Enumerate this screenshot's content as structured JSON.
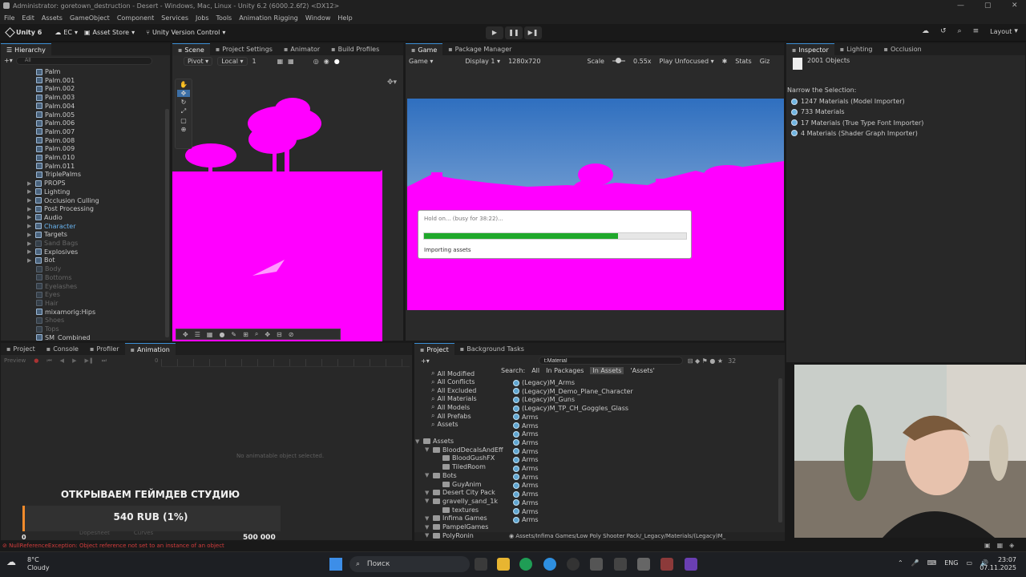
{
  "window": {
    "title": "Administrator: goretown_destruction - Desert - Windows, Mac, Linux - Unity 6.2 (6000.2.6f2) <DX12>"
  },
  "menu": [
    "File",
    "Edit",
    "Assets",
    "GameObject",
    "Component",
    "Services",
    "Jobs",
    "Tools",
    "Animation Rigging",
    "Window",
    "Help"
  ],
  "toolbar": {
    "brand": "Unity 6",
    "account": "EC",
    "asset_store": "Asset Store",
    "version_control": "Unity Version Control",
    "layout": "Layout"
  },
  "hierarchy": {
    "tab": "Hierarchy",
    "search_placeholder": "All",
    "items": [
      {
        "label": "Palm",
        "indent": 2,
        "dim": false
      },
      {
        "label": "Palm.001",
        "indent": 2,
        "dim": false
      },
      {
        "label": "Palm.002",
        "indent": 2,
        "dim": false
      },
      {
        "label": "Palm.003",
        "indent": 2,
        "dim": false
      },
      {
        "label": "Palm.004",
        "indent": 2,
        "dim": false
      },
      {
        "label": "Palm.005",
        "indent": 2,
        "dim": false
      },
      {
        "label": "Palm.006",
        "indent": 2,
        "dim": false
      },
      {
        "label": "Palm.007",
        "indent": 2,
        "dim": false
      },
      {
        "label": "Palm.008",
        "indent": 2,
        "dim": false
      },
      {
        "label": "Palm.009",
        "indent": 2,
        "dim": false
      },
      {
        "label": "Palm.010",
        "indent": 2,
        "dim": false
      },
      {
        "label": "Palm.011",
        "indent": 2,
        "dim": false
      },
      {
        "label": "TriplePalms",
        "indent": 2,
        "dim": false
      },
      {
        "label": "PROPS",
        "indent": 1,
        "dim": false
      },
      {
        "label": "Lighting",
        "indent": 1,
        "dim": false
      },
      {
        "label": "Occlusion Culling",
        "indent": 1,
        "dim": false
      },
      {
        "label": "Post Processing",
        "indent": 1,
        "dim": false
      },
      {
        "label": "Audio",
        "indent": 1,
        "dim": false
      },
      {
        "label": "Character",
        "indent": 1,
        "dim": false,
        "selected": true
      },
      {
        "label": "Targets",
        "indent": 1,
        "dim": false
      },
      {
        "label": "Sand Bags",
        "indent": 1,
        "dim": true
      },
      {
        "label": "Explosives",
        "indent": 1,
        "dim": false
      },
      {
        "label": "Bot",
        "indent": 1,
        "dim": false
      },
      {
        "label": "Body",
        "indent": 2,
        "dim": true
      },
      {
        "label": "Bottoms",
        "indent": 2,
        "dim": true
      },
      {
        "label": "Eyelashes",
        "indent": 2,
        "dim": true
      },
      {
        "label": "Eyes",
        "indent": 2,
        "dim": true
      },
      {
        "label": "Hair",
        "indent": 2,
        "dim": true
      },
      {
        "label": "mixamorig:Hips",
        "indent": 2,
        "dim": false
      },
      {
        "label": "Shoes",
        "indent": 2,
        "dim": true
      },
      {
        "label": "Tops",
        "indent": 2,
        "dim": true
      },
      {
        "label": "SM_Combined",
        "indent": 2,
        "dim": false
      }
    ]
  },
  "scene_tabs": [
    "Scene",
    "Project Settings",
    "Animator",
    "Build Profiles"
  ],
  "scene_toolbar": {
    "pivot": "Pivot",
    "local": "Local",
    "grid": "1"
  },
  "game_tabs": [
    "Game",
    "Package Manager"
  ],
  "game_toolbar": {
    "view": "Game",
    "display": "Display 1",
    "resolution": "1280x720",
    "scale_label": "Scale",
    "scale": "0.55x",
    "play_mode": "Play Unfocused",
    "stats": "Stats",
    "gizmos": "Giz"
  },
  "dialog": {
    "title": "Hold on... (busy for 38:22)...",
    "status": "Importing assets",
    "progress": 0.74
  },
  "inspector": {
    "tabs": [
      "Inspector",
      "Lighting",
      "Occlusion"
    ],
    "objects": "2001 Objects",
    "narrow": "Narrow the Selection:",
    "items": [
      "1247 Materials (Model Importer)",
      "733 Materials",
      "17 Materials (True Type Font Importer)",
      "4 Materials (Shader Graph Importer)"
    ]
  },
  "bottom_left": {
    "tabs": [
      "Project",
      "Console",
      "Profiler",
      "Animation"
    ],
    "preview": "Preview",
    "empty": "No animatable object selected.",
    "sub_tabs": [
      "Dopesheet",
      "Curves"
    ],
    "timeline_zero": "0"
  },
  "stream": {
    "title": "ОТКРЫВАЕМ ГЕЙМДЕВ СТУДИЮ",
    "amount": "540 RUB (1%)",
    "min": "0",
    "max": "500 000"
  },
  "project": {
    "tabs": [
      "Project",
      "Background Tasks"
    ],
    "search_value": "t:Material",
    "count": "32",
    "search_label": "Search:",
    "scopes": [
      "All",
      "In Packages",
      "In Assets",
      "'Assets'"
    ],
    "favorites": [
      "All Modified",
      "All Conflicts",
      "All Excluded",
      "All Materials",
      "All Models",
      "All Prefabs",
      "Assets"
    ],
    "tree": [
      {
        "label": "Assets",
        "indent": 0
      },
      {
        "label": "BloodDecalsAndEff",
        "indent": 1
      },
      {
        "label": "BloodGushFX",
        "indent": 2
      },
      {
        "label": "TiledRoom",
        "indent": 2
      },
      {
        "label": "Bots",
        "indent": 1
      },
      {
        "label": "GuyAnim",
        "indent": 2
      },
      {
        "label": "Desert City Pack",
        "indent": 1
      },
      {
        "label": "gravelly_sand_1k",
        "indent": 1
      },
      {
        "label": "textures",
        "indent": 2
      },
      {
        "label": "Infima Games",
        "indent": 1
      },
      {
        "label": "PampelGames",
        "indent": 1
      },
      {
        "label": "PolyRonin",
        "indent": 1
      }
    ],
    "results": [
      "(Legacy)M_Arms",
      "(Legacy)M_Demo_Plane_Character",
      "(Legacy)M_Guns",
      "(Legacy)M_TP_CH_Goggles_Glass",
      "Arms",
      "Arms",
      "Arms",
      "Arms",
      "Arms",
      "Arms",
      "Arms",
      "Arms",
      "Arms",
      "Arms",
      "Arms",
      "Arms",
      "Arms"
    ],
    "path": "Assets/Infima Games/Low Poly Shooter Pack/_Legacy/Materials/(Legacy)M_"
  },
  "status": {
    "error": "NullReferenceException: Object reference not set to an instance of an object"
  },
  "taskbar": {
    "weather_temp": "8°C",
    "weather_desc": "Cloudy",
    "search": "Поиск",
    "lang": "ENG",
    "time": "23:07",
    "date": "07.11.2025"
  },
  "colors": {
    "accent": "#3c8fd6",
    "magenta": "#ff00ff",
    "progress": "#1fa82b",
    "error": "#d23c3c"
  }
}
